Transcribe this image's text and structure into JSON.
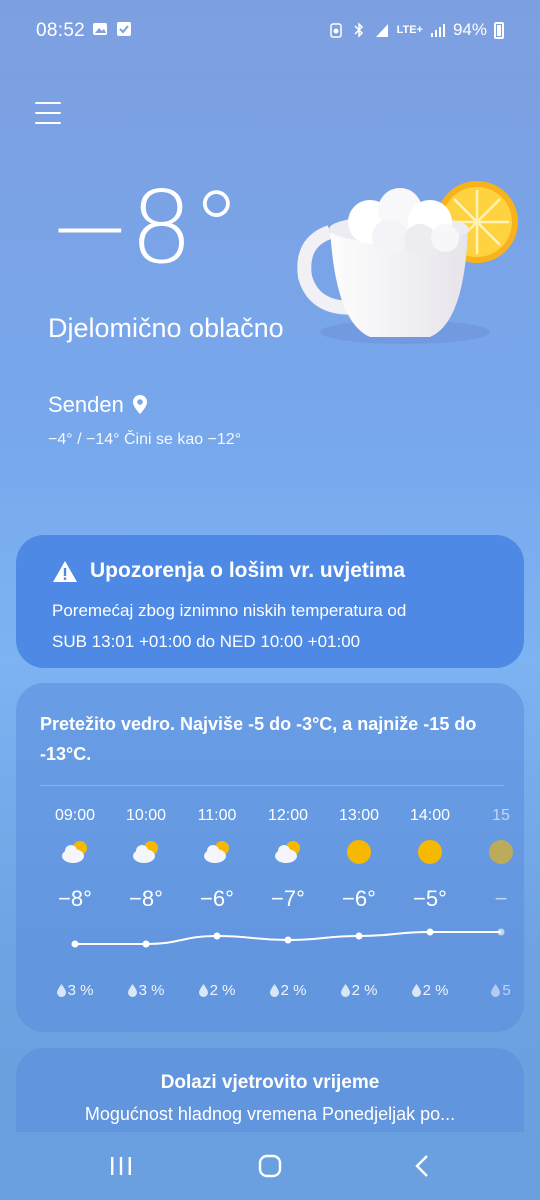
{
  "status_bar": {
    "time": "08:52",
    "battery": "94%",
    "network": "LTE+"
  },
  "current": {
    "temperature": "−8°",
    "condition": "Djelomično oblačno",
    "location": "Senden",
    "range_feels": "−4° / −14° Čini se kao −12°"
  },
  "warning": {
    "title": "Upozorenja o lošim vr. uvjetima",
    "line1": "Poremećaj zbog iznimno niskih temperatura od",
    "line2": "SUB 13:01 +01:00 do NED 10:00 +01:00"
  },
  "forecast": {
    "summary": "Pretežito vedro. Najviše -5 do -3°C, a najniže -15 do -13°C.",
    "hours": [
      {
        "time": "09:00",
        "icon": "partly-cloudy-icon",
        "temp": "−8°",
        "temp_value": -8,
        "precip": "3 %"
      },
      {
        "time": "10:00",
        "icon": "partly-cloudy-icon",
        "temp": "−8°",
        "temp_value": -8,
        "precip": "3 %"
      },
      {
        "time": "11:00",
        "icon": "partly-cloudy-icon",
        "temp": "−6°",
        "temp_value": -6,
        "precip": "2 %"
      },
      {
        "time": "12:00",
        "icon": "partly-cloudy-icon",
        "temp": "−7°",
        "temp_value": -7,
        "precip": "2 %"
      },
      {
        "time": "13:00",
        "icon": "sun-icon",
        "temp": "−6°",
        "temp_value": -6,
        "precip": "2 %"
      },
      {
        "time": "14:00",
        "icon": "sun-icon",
        "temp": "−5°",
        "temp_value": -5,
        "precip": "2 %"
      },
      {
        "time": "15",
        "icon": "sun-icon",
        "temp": "−",
        "temp_value": -5,
        "precip": "5"
      }
    ]
  },
  "wind": {
    "title": "Dolazi vjetrovito vrijeme",
    "body": "Mogućnost hladnog vremena Ponedjeljak po..."
  },
  "colors": {
    "warning_card": "#4e8ae5",
    "sun": "#f6b800"
  }
}
